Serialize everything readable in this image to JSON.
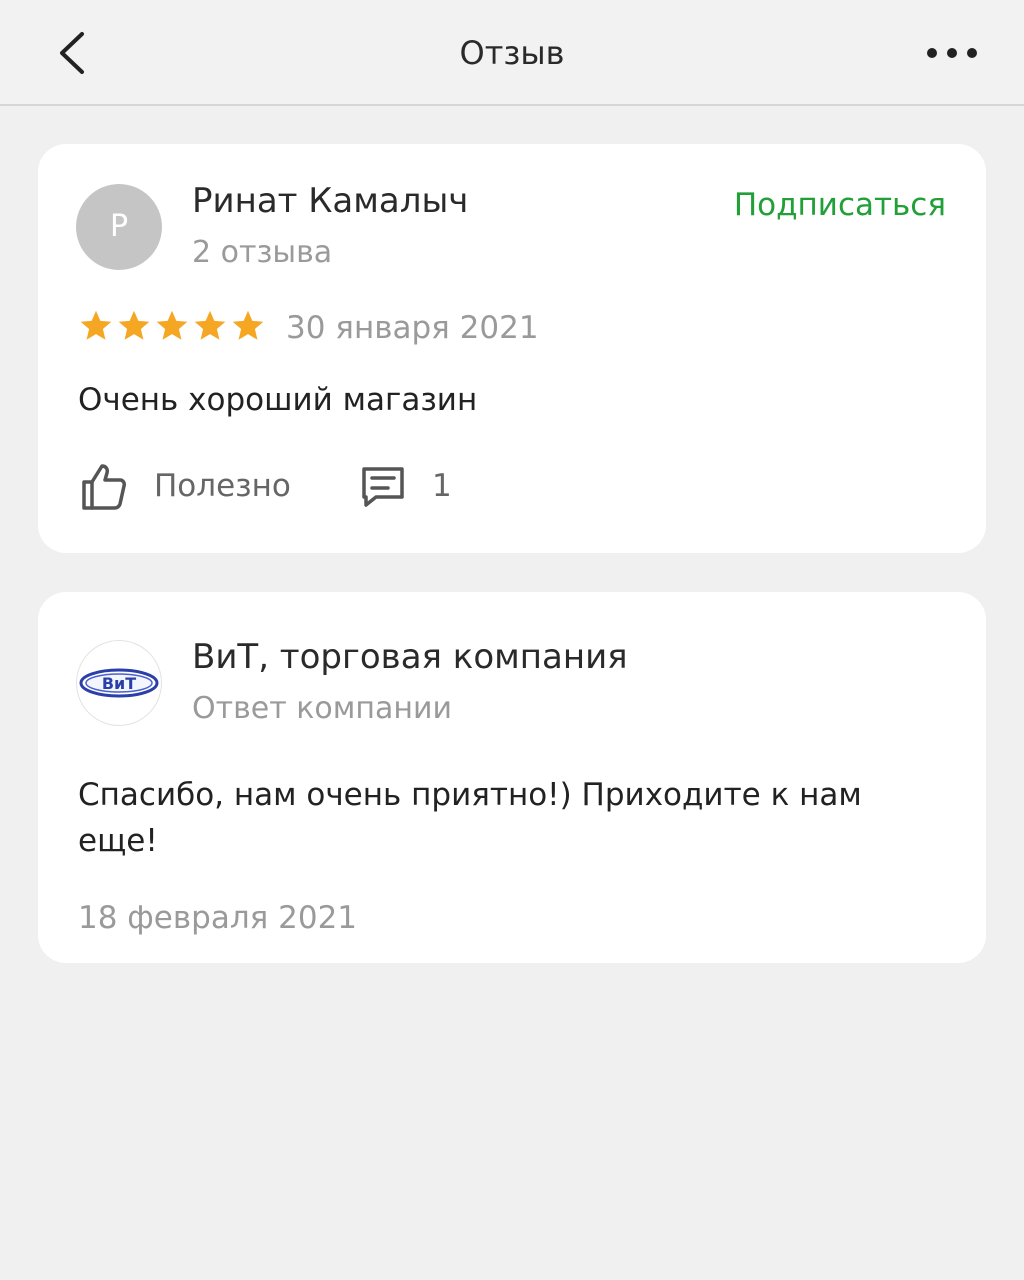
{
  "header": {
    "title": "Отзыв",
    "back_icon": "chevron-left-icon",
    "more_icon": "more-horizontal-icon"
  },
  "review": {
    "avatar_letter": "Р",
    "author_name": "Ринат Камалыч",
    "author_reviews": "2 отзыва",
    "subscribe_label": "Подписаться",
    "rating": 5,
    "rating_max": 5,
    "date": "30 января 2021",
    "text": "Очень хороший магазин",
    "useful_label": "Полезно",
    "comments_count": "1"
  },
  "reply": {
    "company_name": "ВиТ, торговая компания",
    "subtitle": "Ответ компании",
    "text": "Спасибо, нам очень приятно!) Приходите к нам еще!",
    "date": "18 февраля 2021",
    "logo_text": "ВиТ"
  },
  "colors": {
    "accent_green": "#21a038",
    "star": "#f5a623",
    "background": "#f0f0f0",
    "card": "#ffffff",
    "muted_text": "#9a9a9a",
    "logo_blue": "#2b3fa8"
  }
}
